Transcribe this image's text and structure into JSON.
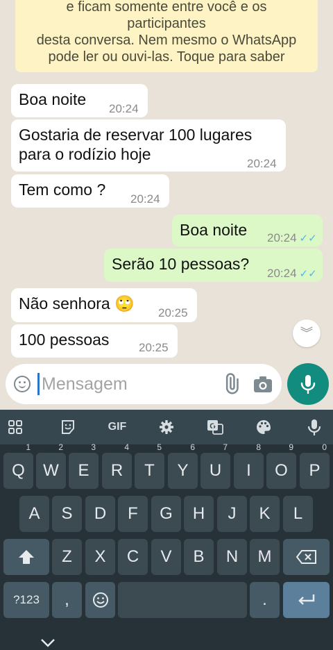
{
  "chat": {
    "banner_lines": [
      "e ficam somente entre você e os",
      "participantes",
      "desta conversa. Nem mesmo o WhatsApp",
      "pode ler ou ouvi-las. Toque para saber"
    ],
    "messages": [
      {
        "direction": "in",
        "lines": [
          "Boa noite"
        ],
        "time": "20:24"
      },
      {
        "direction": "in",
        "lines": [
          "Gostaria de reservar 100 lugares",
          "para o rodízio hoje"
        ],
        "time": "20:24"
      },
      {
        "direction": "in",
        "lines": [
          "Tem como ?"
        ],
        "time": "20:24"
      },
      {
        "direction": "out",
        "lines": [
          "Boa noite"
        ],
        "time": "20:24",
        "status": "read"
      },
      {
        "direction": "out",
        "lines": [
          "Serão 10 pessoas?"
        ],
        "time": "20:24",
        "status": "read"
      },
      {
        "direction": "in",
        "lines": [
          "Não senhora 🙄"
        ],
        "time": "20:25"
      },
      {
        "direction": "in",
        "lines": [
          "100 pessoas"
        ],
        "time": "20:25"
      }
    ]
  },
  "composer": {
    "placeholder": "Mensagem"
  },
  "keyboard": {
    "toolbar": [
      "apps-grid-icon",
      "sticker-icon",
      "GIF",
      "gear-icon",
      "translate-icon",
      "palette-icon",
      "mic-icon"
    ],
    "row1": [
      {
        "k": "Q",
        "h": "1"
      },
      {
        "k": "W",
        "h": "2"
      },
      {
        "k": "E",
        "h": "3"
      },
      {
        "k": "R",
        "h": "4"
      },
      {
        "k": "T",
        "h": "5"
      },
      {
        "k": "Y",
        "h": "6"
      },
      {
        "k": "U",
        "h": "7"
      },
      {
        "k": "I",
        "h": "8"
      },
      {
        "k": "O",
        "h": "9"
      },
      {
        "k": "P",
        "h": "0"
      }
    ],
    "row2": [
      "A",
      "S",
      "D",
      "F",
      "G",
      "H",
      "J",
      "K",
      "L"
    ],
    "row3": [
      "Z",
      "X",
      "C",
      "V",
      "B",
      "N",
      "M"
    ],
    "symbols_label": "?123",
    "comma": ",",
    "period": "."
  },
  "colors": {
    "incoming": "#ffffff",
    "outgoing": "#dcf8c6",
    "accent": "#128c7e",
    "read_ticks": "#4fb6ec",
    "keyboard_bg": "#263238"
  }
}
